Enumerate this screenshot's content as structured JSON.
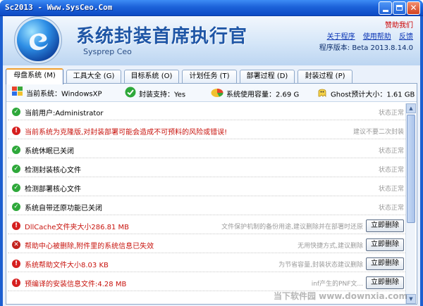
{
  "window": {
    "title": "Sc2013 - Www.SysCeo.Com",
    "title_color": "#ffffff",
    "titlebar_color": "#1c62d9"
  },
  "header": {
    "app_name": "系统封装首席执行官",
    "app_sub": "Sysprep  Ceo",
    "sponsor": "赞助我们",
    "links": [
      "关于程序",
      "使用帮助",
      "反馈"
    ],
    "version": "程序版本: Beta 2013.8.14.0"
  },
  "tabs": [
    {
      "label": "母盘系统 (M)",
      "active": true
    },
    {
      "label": "工具大全 (G)",
      "active": false
    },
    {
      "label": "目标系统 (O)",
      "active": false
    },
    {
      "label": "计划任务 (T)",
      "active": false
    },
    {
      "label": "部署过程 (D)",
      "active": false
    },
    {
      "label": "封装过程 (P)",
      "active": false
    }
  ],
  "info": {
    "current_system": "当前系统：WindowsXP",
    "seal_support": "封装支持：Yes",
    "system_usage": "系统使用容量：2.69 G",
    "ghost_size": "Ghost预计大小：1.61 GB"
  },
  "items": [
    {
      "status": "ok",
      "text": "当前用户:Administrator",
      "right": "状态正常",
      "action": ""
    },
    {
      "status": "warn",
      "text": "当前系统为克隆版,对封装部署可能会造成不可预料的风险或错误!",
      "right": "建议不要二次封装",
      "action": ""
    },
    {
      "status": "ok",
      "text": "系统休眠已关闭",
      "right": "状态正常",
      "action": ""
    },
    {
      "status": "ok",
      "text": "检测封装核心文件",
      "right": "状态正常",
      "action": ""
    },
    {
      "status": "ok",
      "text": "检测部署核心文件",
      "right": "状态正常",
      "action": ""
    },
    {
      "status": "ok",
      "text": "系统自带还原功能已关闭",
      "right": "状态正常",
      "action": ""
    },
    {
      "status": "warn",
      "text": "DllCache文件夹大小286.81 MB",
      "right": "文件保护机制的备份用途,建议删除并在部署时还原",
      "action": "立即删除"
    },
    {
      "status": "err",
      "text": "帮助中心被删除,附件里的系统信息已失效",
      "right": "无用快捷方式,建议删除",
      "action": "立即删除"
    },
    {
      "status": "warn",
      "text": "系统帮助文件大小8.03 KB",
      "right": "为节省容量,封装状态建议删除",
      "action": "立即删除"
    },
    {
      "status": "warn",
      "text": "预编译的安装信息文件:4.28 MB",
      "right": "inf产生的PNF文...",
      "action": "立即删除"
    }
  ],
  "watermark": "当下软件园 www.downxia.com",
  "colors": {
    "ok": "#2ea83a",
    "warn": "#d61f1f",
    "accent_tab": "#f0a030",
    "brand_blue": "#1f56a6"
  }
}
